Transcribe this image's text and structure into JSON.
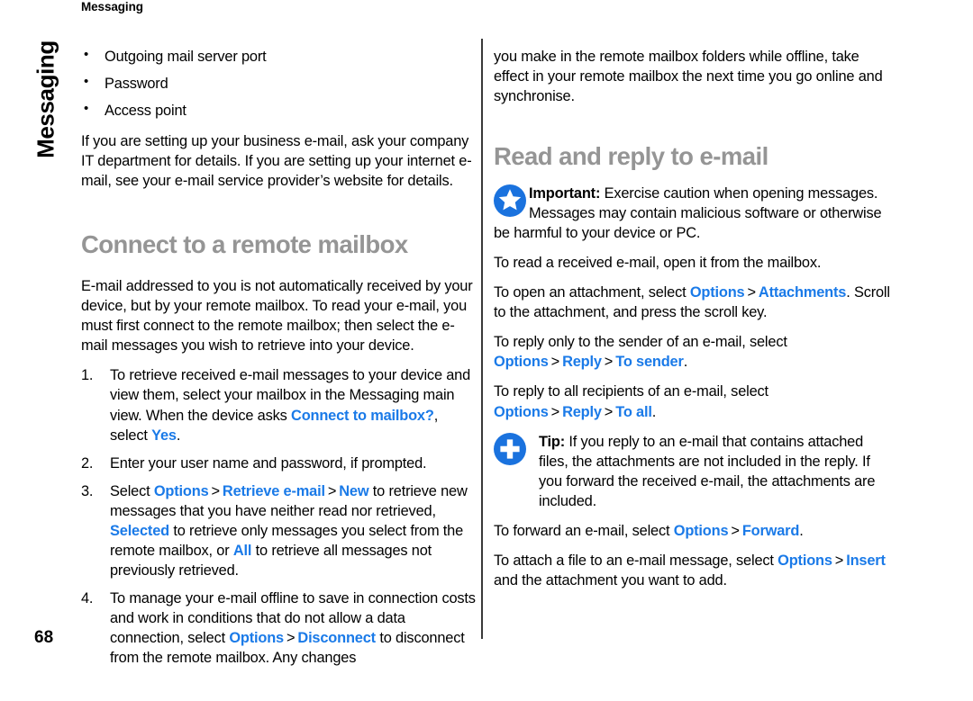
{
  "page": {
    "header": "Messaging",
    "side_tab": "Messaging",
    "number": "68"
  },
  "colors": {
    "ui_term": "#1a7ae8",
    "heading": "#959595",
    "icon_blue": "#1a72de",
    "divider": "#3a3a3a"
  },
  "left_column": {
    "bullets": [
      "Outgoing mail server port",
      "Password",
      "Access point"
    ],
    "intro_paragraph": "If you are setting up your business e-mail, ask your company IT department for details. If you are setting up your internet e-mail, see your e-mail service provider’s website for details.",
    "section_heading": "Connect to a remote mailbox",
    "body_paragraph": "E-mail addressed to you is not automatically received by your device, but by your remote mailbox. To read your e-mail, you must first connect to the remote mailbox; then select the e-mail messages you wish to retrieve into your device.",
    "steps": [
      {
        "number": "1.",
        "parts": [
          {
            "t": "text",
            "v": "To retrieve received e-mail messages to your device and view them, select your mailbox in the Messaging main view. When the device asks "
          },
          {
            "t": "ui",
            "v": "Connect to mailbox?"
          },
          {
            "t": "text",
            "v": ", select "
          },
          {
            "t": "ui",
            "v": "Yes"
          },
          {
            "t": "text",
            "v": "."
          }
        ]
      },
      {
        "number": "2.",
        "parts": [
          {
            "t": "text",
            "v": "Enter your user name and password, if prompted."
          }
        ]
      },
      {
        "number": "3.",
        "parts": [
          {
            "t": "text",
            "v": "Select "
          },
          {
            "t": "ui",
            "v": "Options"
          },
          {
            "t": "gt",
            "v": ">"
          },
          {
            "t": "ui",
            "v": "Retrieve e-mail"
          },
          {
            "t": "gt",
            "v": ">"
          },
          {
            "t": "ui",
            "v": "New"
          },
          {
            "t": "text",
            "v": " to retrieve new messages that you have neither read nor retrieved, "
          },
          {
            "t": "ui",
            "v": "Selected"
          },
          {
            "t": "text",
            "v": " to retrieve only messages you select from the remote mailbox, or "
          },
          {
            "t": "ui",
            "v": "All"
          },
          {
            "t": "text",
            "v": " to retrieve all messages not previously retrieved."
          }
        ]
      },
      {
        "number": "4.",
        "parts": [
          {
            "t": "text",
            "v": "To manage your e-mail offline to save in connection costs and work in conditions that do not allow a data connection, select "
          },
          {
            "t": "ui",
            "v": "Options"
          },
          {
            "t": "gt",
            "v": ">"
          },
          {
            "t": "ui",
            "v": "Disconnect"
          },
          {
            "t": "text",
            "v": " to disconnect from the remote mailbox. Any changes"
          }
        ]
      }
    ]
  },
  "right_column": {
    "continuation_paragraph": "you make in the remote mailbox folders while offline, take effect in your remote mailbox the next time you go online and synchronise.",
    "section_heading": "Read and reply to e-mail",
    "important": {
      "icon": "star-circle-icon",
      "label": "Important:",
      "parts": [
        {
          "t": "bold",
          "v": "Important:"
        },
        {
          "t": "text",
          "v": " Exercise caution when opening messages. Messages may contain malicious software or otherwise be harmful to your device or PC."
        }
      ]
    },
    "paragraphs": [
      {
        "name": "read-email-paragraph",
        "parts": [
          {
            "t": "text",
            "v": "To read a received e-mail, open it from the mailbox."
          }
        ]
      },
      {
        "name": "open-attachment-paragraph",
        "parts": [
          {
            "t": "text",
            "v": "To open an attachment, select "
          },
          {
            "t": "ui",
            "v": "Options"
          },
          {
            "t": "gt",
            "v": ">"
          },
          {
            "t": "ui",
            "v": "Attachments"
          },
          {
            "t": "text",
            "v": ". Scroll to the attachment, and press the scroll key."
          }
        ]
      },
      {
        "name": "reply-sender-paragraph",
        "parts": [
          {
            "t": "text",
            "v": "To reply only to the sender of an e-mail, select "
          },
          {
            "t": "ui",
            "v": "Options"
          },
          {
            "t": "gt",
            "v": ">"
          },
          {
            "t": "ui",
            "v": "Reply"
          },
          {
            "t": "gt",
            "v": ">"
          },
          {
            "t": "ui",
            "v": "To sender"
          },
          {
            "t": "text",
            "v": "."
          }
        ]
      },
      {
        "name": "reply-all-paragraph",
        "parts": [
          {
            "t": "text",
            "v": "To reply to all recipients of an e-mail, select "
          },
          {
            "t": "ui",
            "v": "Options"
          },
          {
            "t": "gt",
            "v": ">"
          },
          {
            "t": "ui",
            "v": "Reply"
          },
          {
            "t": "gt",
            "v": ">"
          },
          {
            "t": "ui",
            "v": "To all"
          },
          {
            "t": "text",
            "v": "."
          }
        ]
      }
    ],
    "tip": {
      "icon": "plus-circle-icon",
      "label": "Tip:",
      "parts": [
        {
          "t": "bold",
          "v": "Tip:"
        },
        {
          "t": "text",
          "v": " If you reply to an e-mail that contains attached files, the attachments are not included in the reply. If you forward the received e-mail, the attachments are included."
        }
      ]
    },
    "paragraphs_after": [
      {
        "name": "forward-email-paragraph",
        "parts": [
          {
            "t": "text",
            "v": "To forward an e-mail, select "
          },
          {
            "t": "ui",
            "v": "Options"
          },
          {
            "t": "gt",
            "v": ">"
          },
          {
            "t": "ui",
            "v": "Forward"
          },
          {
            "t": "text",
            "v": "."
          }
        ]
      },
      {
        "name": "attach-file-paragraph",
        "parts": [
          {
            "t": "text",
            "v": "To attach a file to an e-mail message, select "
          },
          {
            "t": "ui",
            "v": "Options"
          },
          {
            "t": "gt",
            "v": ">"
          },
          {
            "t": "ui",
            "v": "Insert"
          },
          {
            "t": "text",
            "v": " and the attachment you want to add."
          }
        ]
      }
    ]
  }
}
